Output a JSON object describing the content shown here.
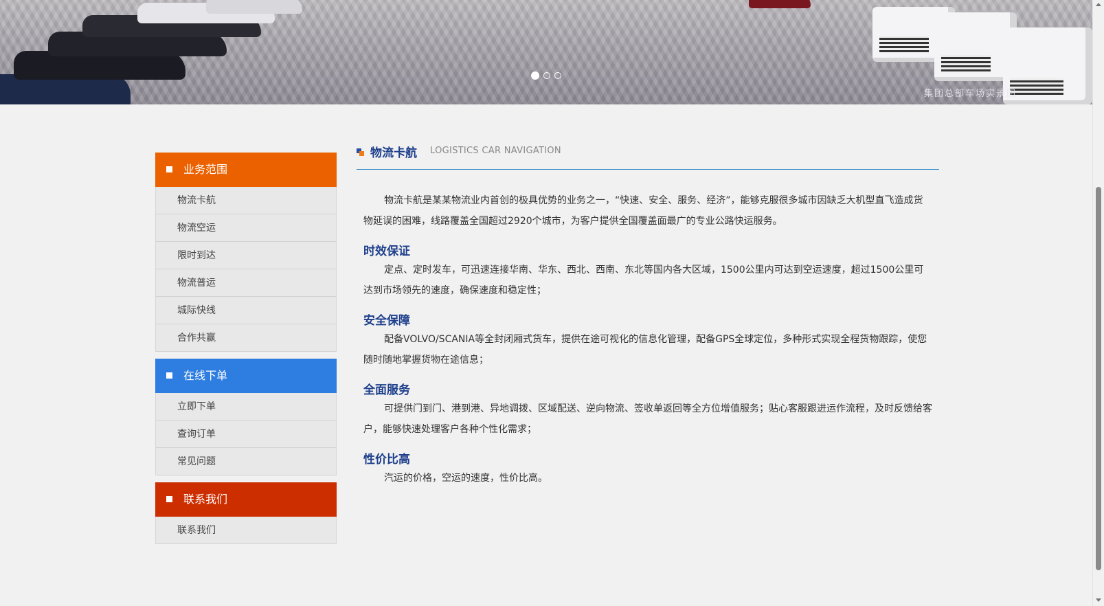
{
  "banner": {
    "caption": "集团总部车场实景图",
    "slides": 3,
    "active_slide": 1
  },
  "sidebar": {
    "groups": [
      {
        "title": "业务范围",
        "color": "#eb6100",
        "items": [
          "物流卡航",
          "物流空运",
          "限时到达",
          "物流普运",
          "城际快线",
          "合作共赢"
        ]
      },
      {
        "title": "在线下单",
        "color": "#2e7de0",
        "items": [
          "立即下单",
          "查询订单",
          "常见问题"
        ]
      },
      {
        "title": "联系我们",
        "color": "#cc2e00",
        "items": [
          "联系我们"
        ]
      }
    ]
  },
  "content": {
    "title_cn": "物流卡航",
    "title_en": "LOGISTICS CAR NAVIGATION",
    "intro": "物流卡航是某某物流业内首创的极具优势的业务之一，“快速、安全、服务、经济”，能够克服很多城市因缺乏大机型直飞造成货物延误的困难，线路覆盖全国超过2920个城市，为客户提供全国覆盖面最广的专业公路快运服务。",
    "sections": [
      {
        "heading": "时效保证",
        "text": "定点、定时发车，可迅速连接华南、华东、西北、西南、东北等国内各大区域，1500公里内可达到空运速度，超过1500公里可达到市场领先的速度，确保速度和稳定性；"
      },
      {
        "heading": "安全保障",
        "text": "配备VOLVO/SCANIA等全封闭厢式货车，提供在途可视化的信息化管理，配备GPS全球定位，多种形式实现全程货物跟踪，使您随时随地掌握货物在途信息；"
      },
      {
        "heading": "全面服务",
        "text": "可提供门到门、港到港、异地调拨、区域配送、逆向物流、签收单返回等全方位增值服务；贴心客服跟进运作流程，及时反馈给客户，能够快速处理客户各种个性化需求；"
      },
      {
        "heading": "性价比高",
        "text": "汽运的价格，空运的速度，性价比高。"
      }
    ]
  },
  "colors": {
    "accent_blue": "#1e3f8c",
    "title_rule": "#2a88c4"
  }
}
